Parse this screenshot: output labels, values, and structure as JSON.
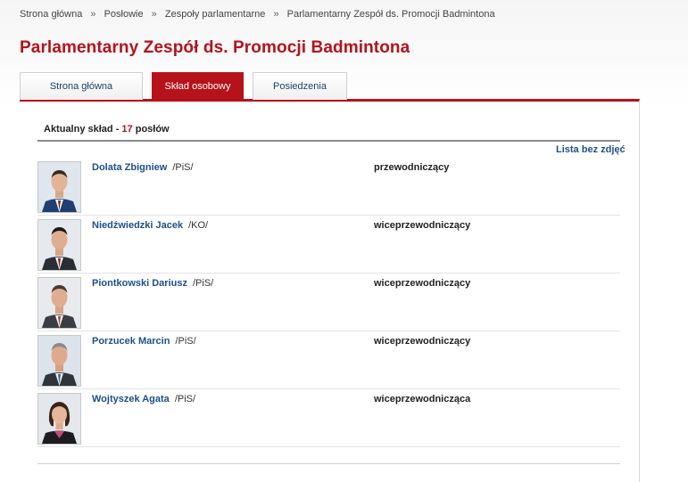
{
  "breadcrumb": {
    "items": [
      "Strona główna",
      "Posłowie",
      "Zespoły parlamentarne",
      "Parlamentarny Zespół ds. Promocji Badmintona"
    ],
    "separator": "»"
  },
  "page": {
    "title": "Parlamentarny Zespół ds. Promocji Badmintona"
  },
  "tabs": [
    {
      "label": "Strona główna",
      "active": false
    },
    {
      "label": "Skład osobowy",
      "active": true
    },
    {
      "label": "Posiedzenia",
      "active": false
    }
  ],
  "composition": {
    "label": "Aktualny skład - ",
    "count": "17",
    "unit": " posłów"
  },
  "list_without_photos": "Lista bez zdjęć",
  "members": [
    {
      "name": "Dolata Zbigniew",
      "club": "/PiS/",
      "role": "przewodniczący",
      "photo_icon": "person-portrait-icon"
    },
    {
      "name": "Niedźwiedzki Jacek",
      "club": "/KO/",
      "role": "wiceprzewodniczący",
      "photo_icon": "person-portrait-icon"
    },
    {
      "name": "Piontkowski Dariusz",
      "club": "/PiS/",
      "role": "wiceprzewodniczący",
      "photo_icon": "person-portrait-icon"
    },
    {
      "name": "Porzucek Marcin",
      "club": "/PiS/",
      "role": "wiceprzewodniczący",
      "photo_icon": "person-portrait-icon"
    },
    {
      "name": "Wojtyszek Agata",
      "club": "/PiS/",
      "role": "wiceprzewodnicząca",
      "photo_icon": "person-portrait-icon"
    }
  ],
  "colors": {
    "accent": "#b5121b",
    "link": "#1d4f8a"
  }
}
